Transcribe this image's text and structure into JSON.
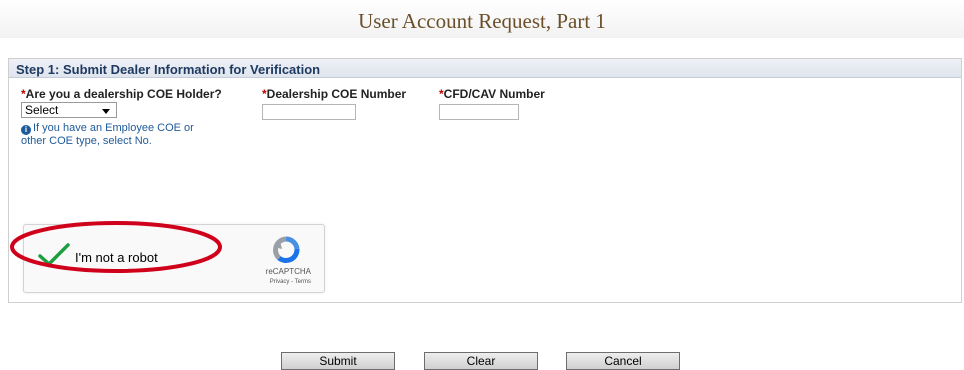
{
  "page": {
    "title": "User Account Request, Part 1"
  },
  "step": {
    "heading": "Step 1: Submit Dealer Information for Verification"
  },
  "fields": {
    "coe_holder": {
      "required_mark": "*",
      "label": "Are you a dealership COE Holder?",
      "selected": "Select"
    },
    "info_text": "If you have an Employee COE or other COE type, select No.",
    "dealership_coe": {
      "required_mark": "*",
      "label": "Dealership COE Number",
      "value": ""
    },
    "cfd_cav": {
      "required_mark": "*",
      "label": "CFD/CAV Number",
      "value": ""
    }
  },
  "recaptcha": {
    "label": "I'm not a robot",
    "brand": "reCAPTCHA",
    "links": "Privacy - Terms",
    "checked": true
  },
  "colors": {
    "title": "#6b4f2a",
    "heading": "#1f3a60",
    "required": "#c00000",
    "info": "#1f5a99",
    "highlight": "#d0021b",
    "check": "#1e9e3f"
  },
  "buttons": {
    "submit": "Submit",
    "clear": "Clear",
    "cancel": "Cancel"
  }
}
